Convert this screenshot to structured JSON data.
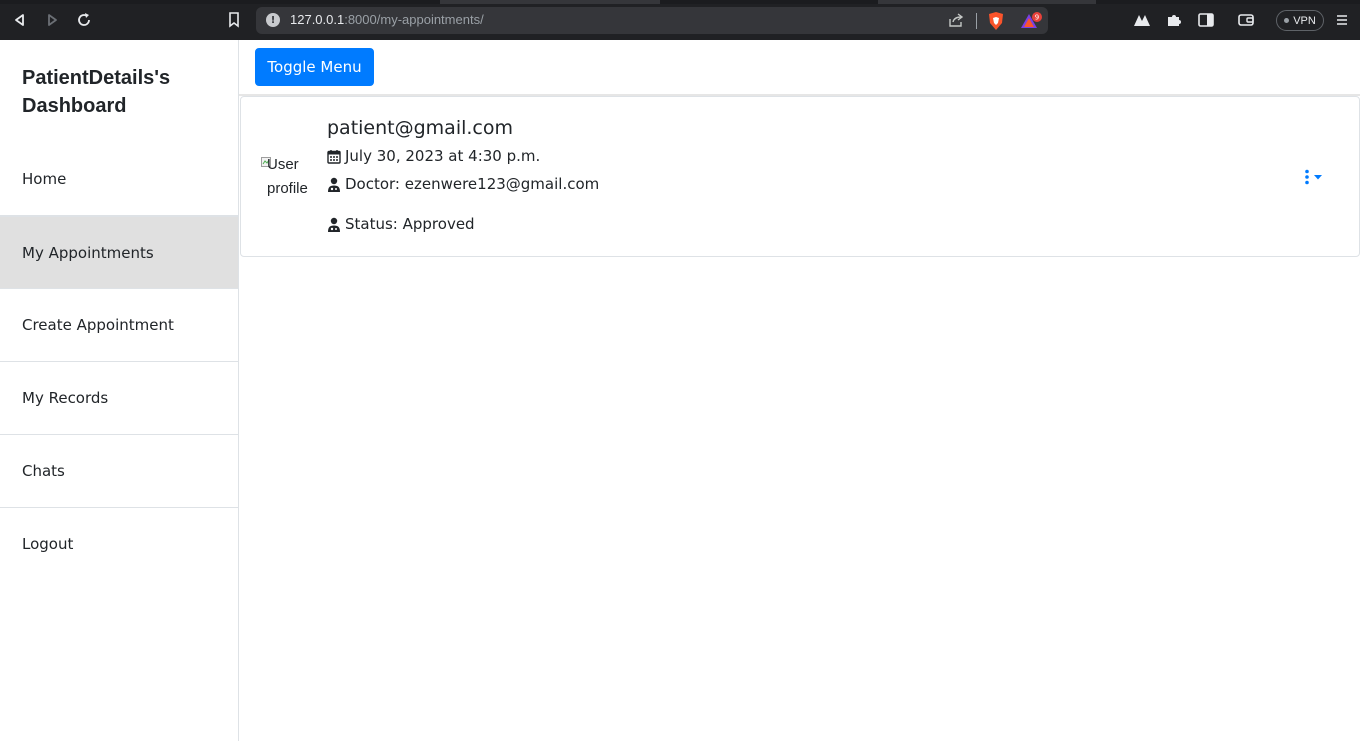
{
  "browser": {
    "url_host": "127.0.0.1",
    "url_path": ":8000/my-appointments/",
    "rewards_badge": "9",
    "vpn_label": "VPN",
    "icons": [
      "back-icon",
      "forward-icon",
      "reload-icon",
      "bookmark-icon",
      "info-icon",
      "share-icon",
      "brave-shield-icon",
      "brave-rewards-icon",
      "brave-logo-icon",
      "extensions-icon",
      "sidebar-icon",
      "wallet-icon",
      "menu-icon"
    ]
  },
  "sidebar": {
    "title": "PatientDetails's Dashboard",
    "items": [
      {
        "label": "Home",
        "active": false
      },
      {
        "label": "My Appointments",
        "active": true
      },
      {
        "label": "Create Appointment",
        "active": false
      },
      {
        "label": "My Records",
        "active": false
      },
      {
        "label": "Chats",
        "active": false
      },
      {
        "label": "Logout",
        "active": false
      }
    ]
  },
  "main": {
    "toggle_label": "Toggle Menu",
    "appointment": {
      "avatar_alt": "User profile",
      "email": "patient@gmail.com",
      "date": "July 30, 2023 at 4:30 p.m.",
      "doctor": "Doctor: ezenwere123@gmail.com",
      "status": "Status: Approved"
    }
  },
  "colors": {
    "accent": "#007bff",
    "active_nav_bg": "#e0e0e0",
    "chrome_bg": "#202124"
  }
}
